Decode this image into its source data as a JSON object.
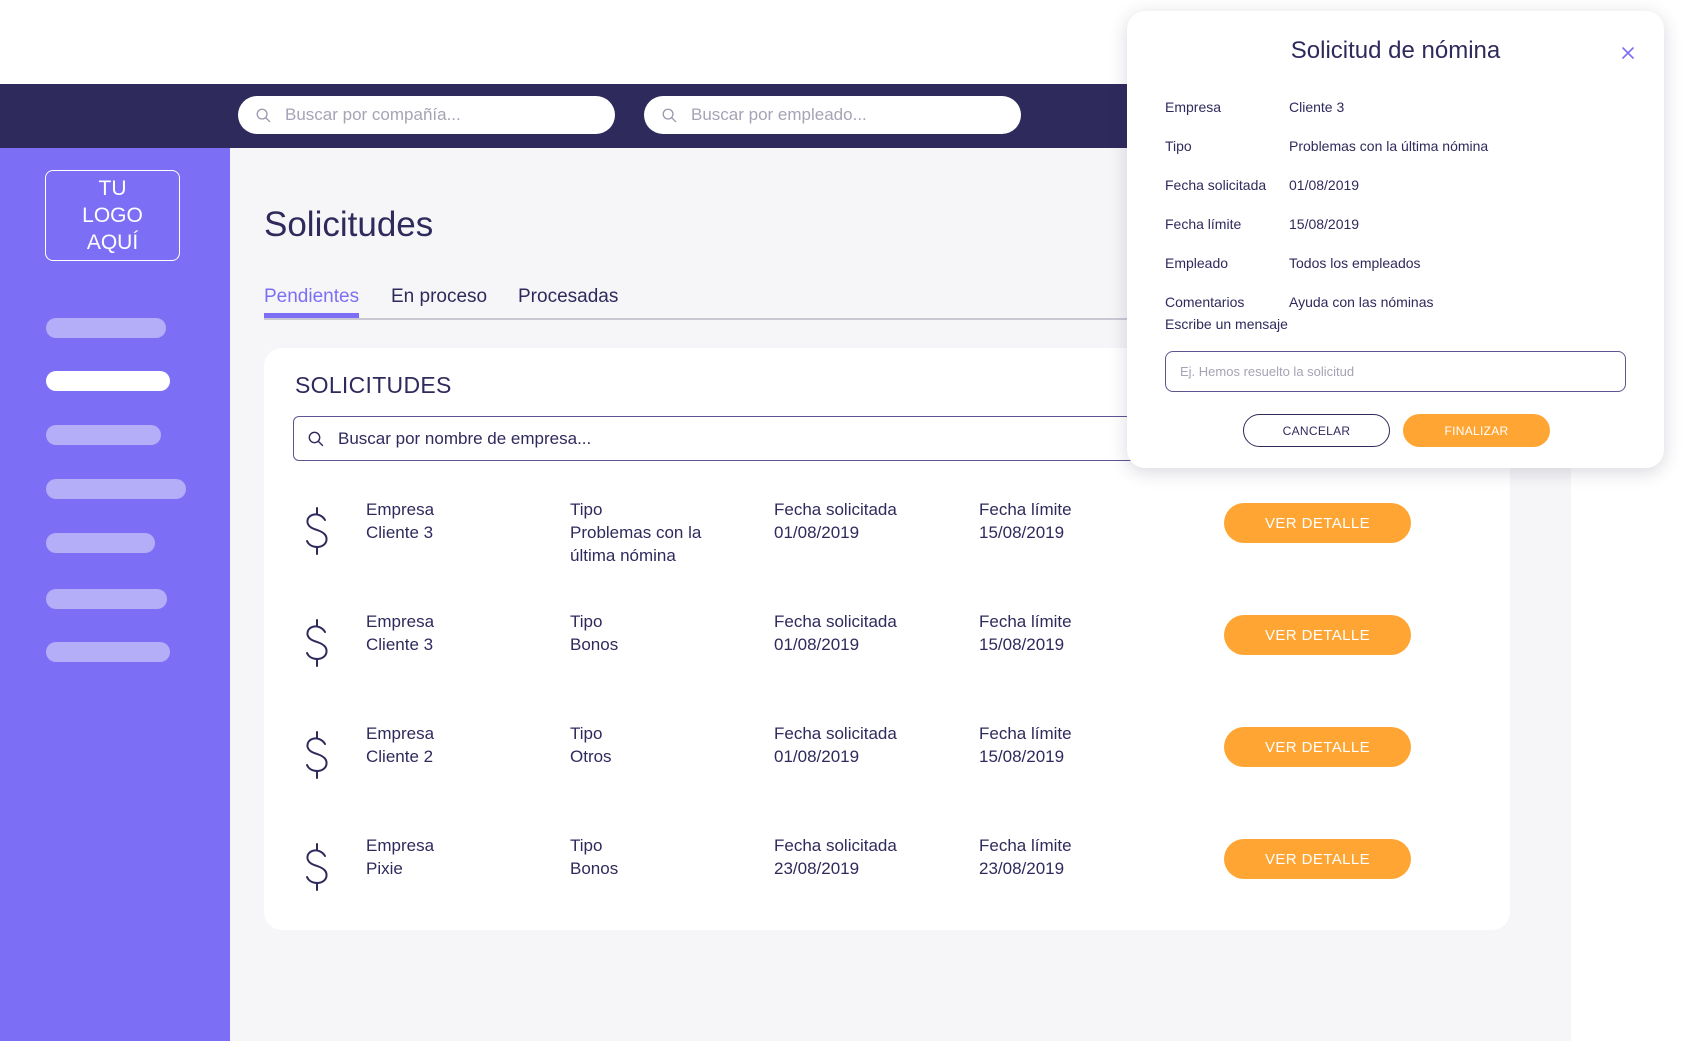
{
  "header": {
    "search_company_placeholder": "Buscar por compañía...",
    "search_employee_placeholder": "Buscar por empleado..."
  },
  "sidebar": {
    "logo_text": "TU\nLOGO\nAQUÍ"
  },
  "main": {
    "title": "Solicitudes",
    "tabs": [
      {
        "label": "Pendientes",
        "active": true
      },
      {
        "label": "En proceso",
        "active": false
      },
      {
        "label": "Procesadas",
        "active": false
      }
    ],
    "card": {
      "title": "SOLICITUDES",
      "search_placeholder": "Buscar por nombre de empresa...",
      "labels": {
        "empresa": "Empresa",
        "tipo": "Tipo",
        "fecha_solicitada": "Fecha solicitada",
        "fecha_limite": "Fecha límite"
      },
      "button_label": "VER DETALLE",
      "rows": [
        {
          "empresa": "Cliente 3",
          "tipo": "Problemas con la última nómina",
          "fecha_solicitada": "01/08/2019",
          "fecha_limite": "15/08/2019"
        },
        {
          "empresa": "Cliente 3",
          "tipo": "Bonos",
          "fecha_solicitada": "01/08/2019",
          "fecha_limite": "15/08/2019"
        },
        {
          "empresa": "Cliente 2",
          "tipo": "Otros",
          "fecha_solicitada": "01/08/2019",
          "fecha_limite": "15/08/2019"
        },
        {
          "empresa": "Pixie",
          "tipo": "Bonos",
          "fecha_solicitada": "23/08/2019",
          "fecha_limite": "23/08/2019"
        }
      ]
    }
  },
  "modal": {
    "title": "Solicitud de nómina",
    "details": [
      {
        "key": "Empresa",
        "value": "Cliente 3"
      },
      {
        "key": "Tipo",
        "value": "Problemas con la última nómina"
      },
      {
        "key": "Fecha solicitada",
        "value": "01/08/2019"
      },
      {
        "key": "Fecha límite",
        "value": "15/08/2019"
      },
      {
        "key": "Empleado",
        "value": "Todos los empleados"
      },
      {
        "key": "Comentarios",
        "value": "Ayuda con las nóminas"
      }
    ],
    "message_label": "Escribe un mensaje",
    "message_placeholder": "Ej. Hemos resuelto la solicitud",
    "cancel_label": "CANCELAR",
    "finish_label": "FINALIZAR"
  },
  "colors": {
    "header": "#2f2a5c",
    "sidebar": "#7c6ff5",
    "accent": "#ffa534",
    "text": "#2f2a5c"
  }
}
